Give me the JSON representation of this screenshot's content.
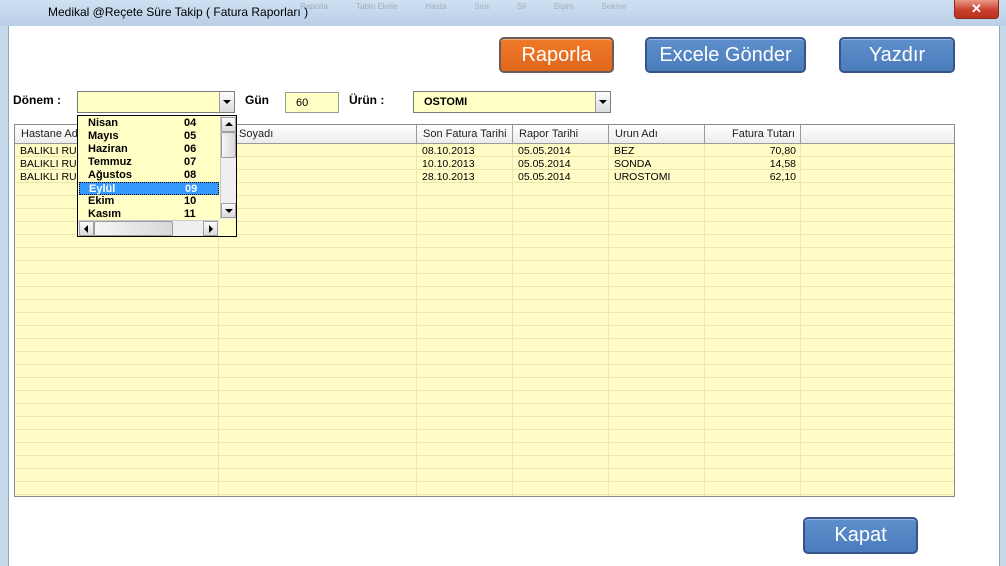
{
  "window": {
    "title": "Medikal  @Reçete Süre Takip ( Fatura Raporları )",
    "close_glyph": "✕"
  },
  "toolbar_ghost": [
    "Raporla",
    "Tablo Ekele",
    "Hasta",
    "Sıra",
    "Sil",
    "Bişim",
    "Sekme"
  ],
  "buttons": {
    "raporla": "Raporla",
    "excel": "Excele Gönder",
    "yazdir": "Yazdır",
    "kapat": "Kapat"
  },
  "filters": {
    "donem_label": "Dönem :",
    "donem_value": "",
    "gun_label": "Gün",
    "gun_value": "60",
    "urun_label": "Ürün :",
    "urun_value": "OSTOMI"
  },
  "dropdown": {
    "items": [
      {
        "name": "Nisan",
        "code": "04"
      },
      {
        "name": "Mayıs",
        "code": "05"
      },
      {
        "name": "Haziran",
        "code": "06"
      },
      {
        "name": "Temmuz",
        "code": "07"
      },
      {
        "name": "Ağustos",
        "code": "08"
      },
      {
        "name": "Eylül",
        "code": "09"
      },
      {
        "name": "Ekim",
        "code": "10"
      },
      {
        "name": "Kasım",
        "code": "11"
      }
    ],
    "selected_index": 5
  },
  "grid": {
    "columns": [
      "Hastane Adı",
      "",
      "Soyadı",
      "Son Fatura Tarihi",
      "Rapor Tarihi",
      "Urun Adı",
      "Fatura Tutarı"
    ],
    "rows": [
      [
        "BALIKLI RUM",
        "",
        "",
        "08.10.2013",
        "05.05.2014",
        "BEZ",
        "70,80"
      ],
      [
        "BALIKLI RUM",
        "",
        "",
        "10.10.2013",
        "05.05.2014",
        "SONDA",
        "14,58"
      ],
      [
        "BALIKLI RUM",
        "",
        "",
        "28.10.2013",
        "05.05.2014",
        "UROSTOMI",
        "62,10"
      ]
    ]
  },
  "colors": {
    "accent_orange": "#e86f20",
    "button_blue": "#4f80c1",
    "grid_background": "#fffcc6",
    "selection_blue": "#3399ff"
  }
}
